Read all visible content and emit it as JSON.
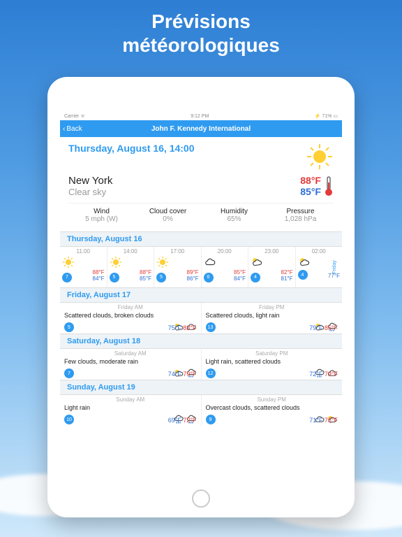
{
  "page_title_l1": "Prévisions",
  "page_title_l2": "météorologiques",
  "status": {
    "carrier": "Carrier",
    "time": "9:12 PM",
    "battery": "71%"
  },
  "nav": {
    "back": "Back",
    "title": "John F. Kennedy International"
  },
  "hero": {
    "date": "Thursday, August 16, 14:00",
    "location": "New York",
    "condition": "Clear sky",
    "hi": "88°F",
    "lo": "85°F"
  },
  "metrics": {
    "wind_label": "Wind",
    "wind_value": "5 mph (W)",
    "cloud_label": "Cloud cover",
    "cloud_value": "0%",
    "humidity_label": "Humidity",
    "humidity_value": "65%",
    "pressure_label": "Pressure",
    "pressure_value": "1,028 hPa"
  },
  "hourly_header": "Thursday, August 16",
  "hourly": [
    {
      "time": "11:00",
      "icon": "sun",
      "wind": "7",
      "hi": "88°F",
      "lo": "84°F"
    },
    {
      "time": "14:00",
      "icon": "sun",
      "wind": "5",
      "hi": "88°F",
      "lo": "85°F"
    },
    {
      "time": "17:00",
      "icon": "sun",
      "wind": "5",
      "hi": "89°F",
      "lo": "86°F"
    },
    {
      "time": "20:00",
      "icon": "cloud",
      "wind": "6",
      "hi": "85°F",
      "lo": "84°F"
    },
    {
      "time": "23:00",
      "icon": "suncloud",
      "wind": "4",
      "hi": "82°F",
      "lo": "81°F"
    },
    {
      "time": "02:00",
      "icon": "suncloud",
      "wind": "4",
      "hi": "",
      "lo": "77°F",
      "daylabel": "Friday"
    }
  ],
  "days": [
    {
      "header": "Friday, August 17",
      "am_label": "Friday AM",
      "pm_label": "Friday PM",
      "am_desc": "Scattered clouds, broken clouds",
      "pm_desc": "Scattered clouds, light rain",
      "am_wind": "5",
      "pm_wind": "13",
      "am_lo": "75°F",
      "am_hi": "83°F",
      "pm_lo": "79°F",
      "pm_hi": "85°F",
      "am_icon1": "suncloud",
      "am_icon2": "cloud",
      "pm_icon1": "suncloud",
      "pm_icon2": "rain"
    },
    {
      "header": "Saturday, August 18",
      "am_label": "Saturday AM",
      "pm_label": "Saturday PM",
      "am_desc": "Few clouds, moderate rain",
      "pm_desc": "Light rain, scattered clouds",
      "am_wind": "7",
      "pm_wind": "12",
      "am_lo": "74°F",
      "am_hi": "79°F",
      "pm_lo": "72°F",
      "pm_hi": "79°F",
      "am_icon1": "suncloud",
      "am_icon2": "rain",
      "pm_icon1": "rain",
      "pm_icon2": "cloud"
    },
    {
      "header": "Sunday, August 19",
      "am_label": "Sunday AM",
      "pm_label": "Sunday PM",
      "am_desc": "Light rain",
      "pm_desc": "Overcast clouds, scattered clouds",
      "am_wind": "10",
      "pm_wind": "9",
      "am_lo": "69°F",
      "am_hi": "72°F",
      "pm_lo": "71°F",
      "pm_hi": "75°F",
      "am_icon1": "rain",
      "am_icon2": "rain",
      "pm_icon1": "cloud",
      "pm_icon2": "suncloud"
    }
  ]
}
